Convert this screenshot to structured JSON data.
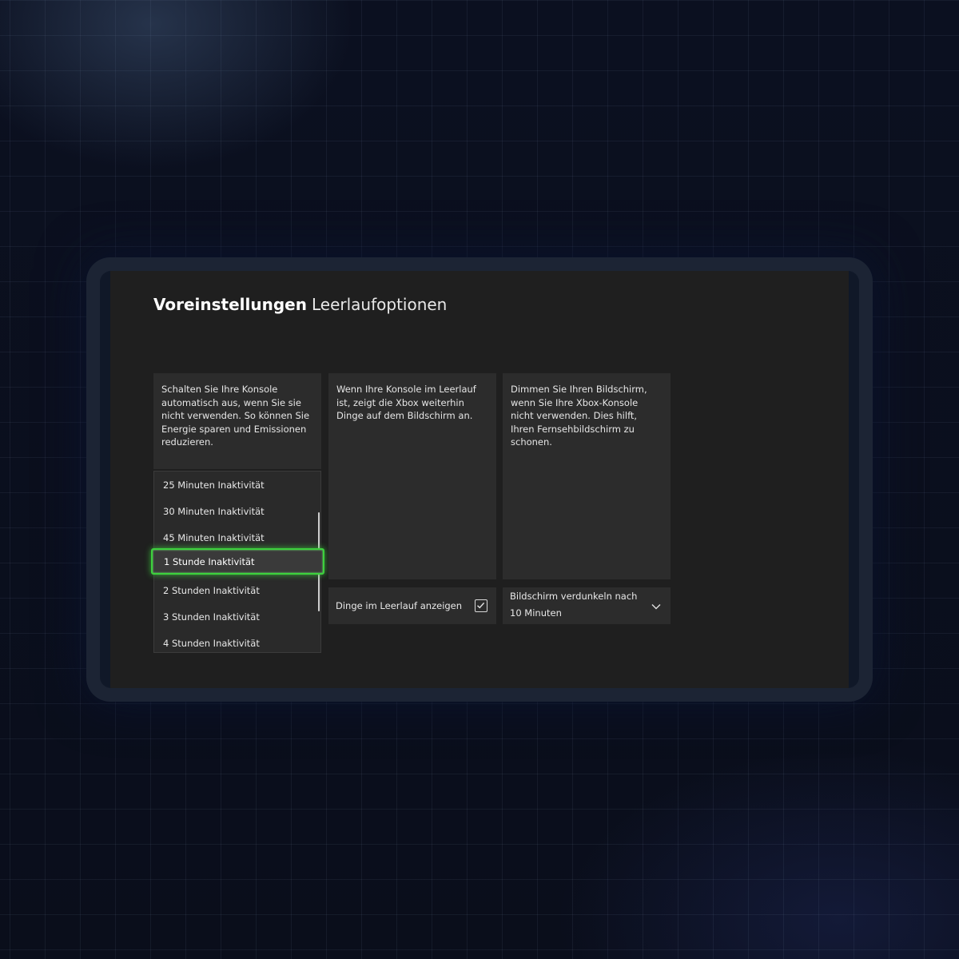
{
  "header": {
    "section": "Voreinstellungen",
    "page": "Leerlaufoptionen"
  },
  "auto_off": {
    "description": "Schalten Sie Ihre Konsole automatisch aus, wenn Sie sie nicht verwenden. So können Sie Energie sparen und Emissionen reduzieren.",
    "options": [
      "25 Minuten Inaktivität",
      "30 Minuten Inaktivität",
      "45 Minuten Inaktivität",
      "1 Stunde Inaktivität",
      "2 Stunden Inaktivität",
      "3 Stunden Inaktivität",
      "4 Stunden Inaktivität"
    ],
    "selected": "1 Stunde Inaktivität"
  },
  "idle_display": {
    "description": "Wenn Ihre Konsole im Leerlauf ist, zeigt die Xbox weiterhin Dinge auf dem Bildschirm an.",
    "checkbox_label": "Dinge im Leerlauf anzeigen",
    "checked": true
  },
  "dim_screen": {
    "description": "Dimmen Sie Ihren Bildschirm, wenn Sie Ihre Xbox-Konsole nicht verwenden. Dies hilft, Ihren Fernsehbildschirm zu schonen.",
    "select_label": "Bildschirm verdunkeln nach",
    "select_value": "10 Minuten"
  },
  "colors": {
    "focus": "#3dd13d",
    "screen_bg": "#1f1f1f",
    "panel_bg": "#2c2c2c"
  },
  "icons": {
    "checkbox": "checkmark-icon",
    "select": "chevron-down-icon"
  }
}
